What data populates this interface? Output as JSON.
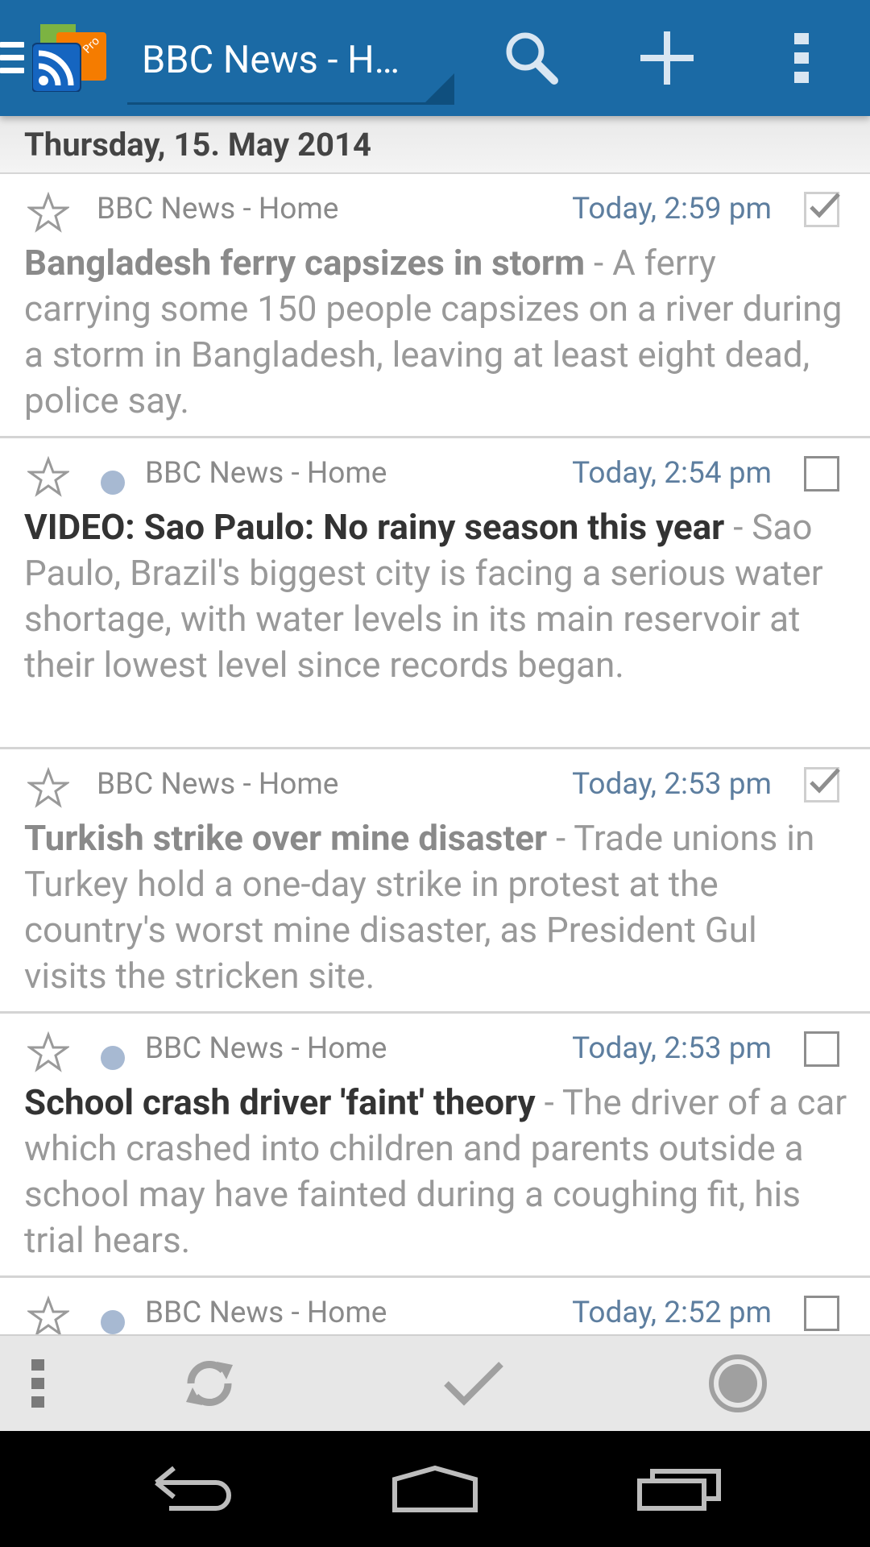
{
  "toolbar": {
    "title": "BBC News - H…"
  },
  "date_header": "Thursday, 15. May 2014",
  "articles": [
    {
      "feed": "BBC News - Home",
      "time": "Today, 2:59 pm",
      "title": "Bangladesh ferry capsizes in storm",
      "separator": " - ",
      "description": "A ferry carrying some 150 people capsizes on a river during a storm in Bangladesh, leaving at least eight dead, police say."
    },
    {
      "feed": "BBC News - Home",
      "time": "Today, 2:54 pm",
      "title": "VIDEO: Sao Paulo: No rainy season this year",
      "separator": " - ",
      "description": "Sao Paulo, Brazil's biggest city is facing a serious water shortage, with water levels in its main reservoir at their lowest level since records began."
    },
    {
      "feed": "BBC News - Home",
      "time": "Today, 2:53 pm",
      "title": "Turkish strike over mine disaster",
      "separator": " - ",
      "description": "Trade unions in Turkey hold a one-day strike in protest at the country's worst mine disaster, as President Gul visits the stricken site."
    },
    {
      "feed": "BBC News - Home",
      "time": "Today, 2:53 pm",
      "title": "School crash driver 'faint' theory",
      "separator": " - ",
      "description": "The driver of a car which crashed into children and parents outside a school may have fainted during a coughing fit, his trial hears."
    },
    {
      "feed": "BBC News - Home",
      "time": "Today, 2:52 pm",
      "title": "",
      "separator": "",
      "description": ""
    }
  ],
  "icons": {
    "drawer": "hamburger-icon",
    "app": "rss-app-icon",
    "search": "search-icon",
    "add": "plus-icon",
    "overflow": "overflow-menu-icon",
    "star": "star-outline-icon",
    "check": "checkmark-icon",
    "refresh": "refresh-icon",
    "mark_all": "checkmark-icon",
    "unread_filter": "radio-icon",
    "back": "back-icon",
    "home": "home-icon",
    "recents": "recents-icon"
  },
  "colors": {
    "action_bar": "#1b6aa5",
    "time_text": "#5d7e9f",
    "unread_dot": "#a7b9d2",
    "logo_green": "#7cb342",
    "logo_orange": "#f57c00",
    "logo_blue": "#1565c0"
  }
}
